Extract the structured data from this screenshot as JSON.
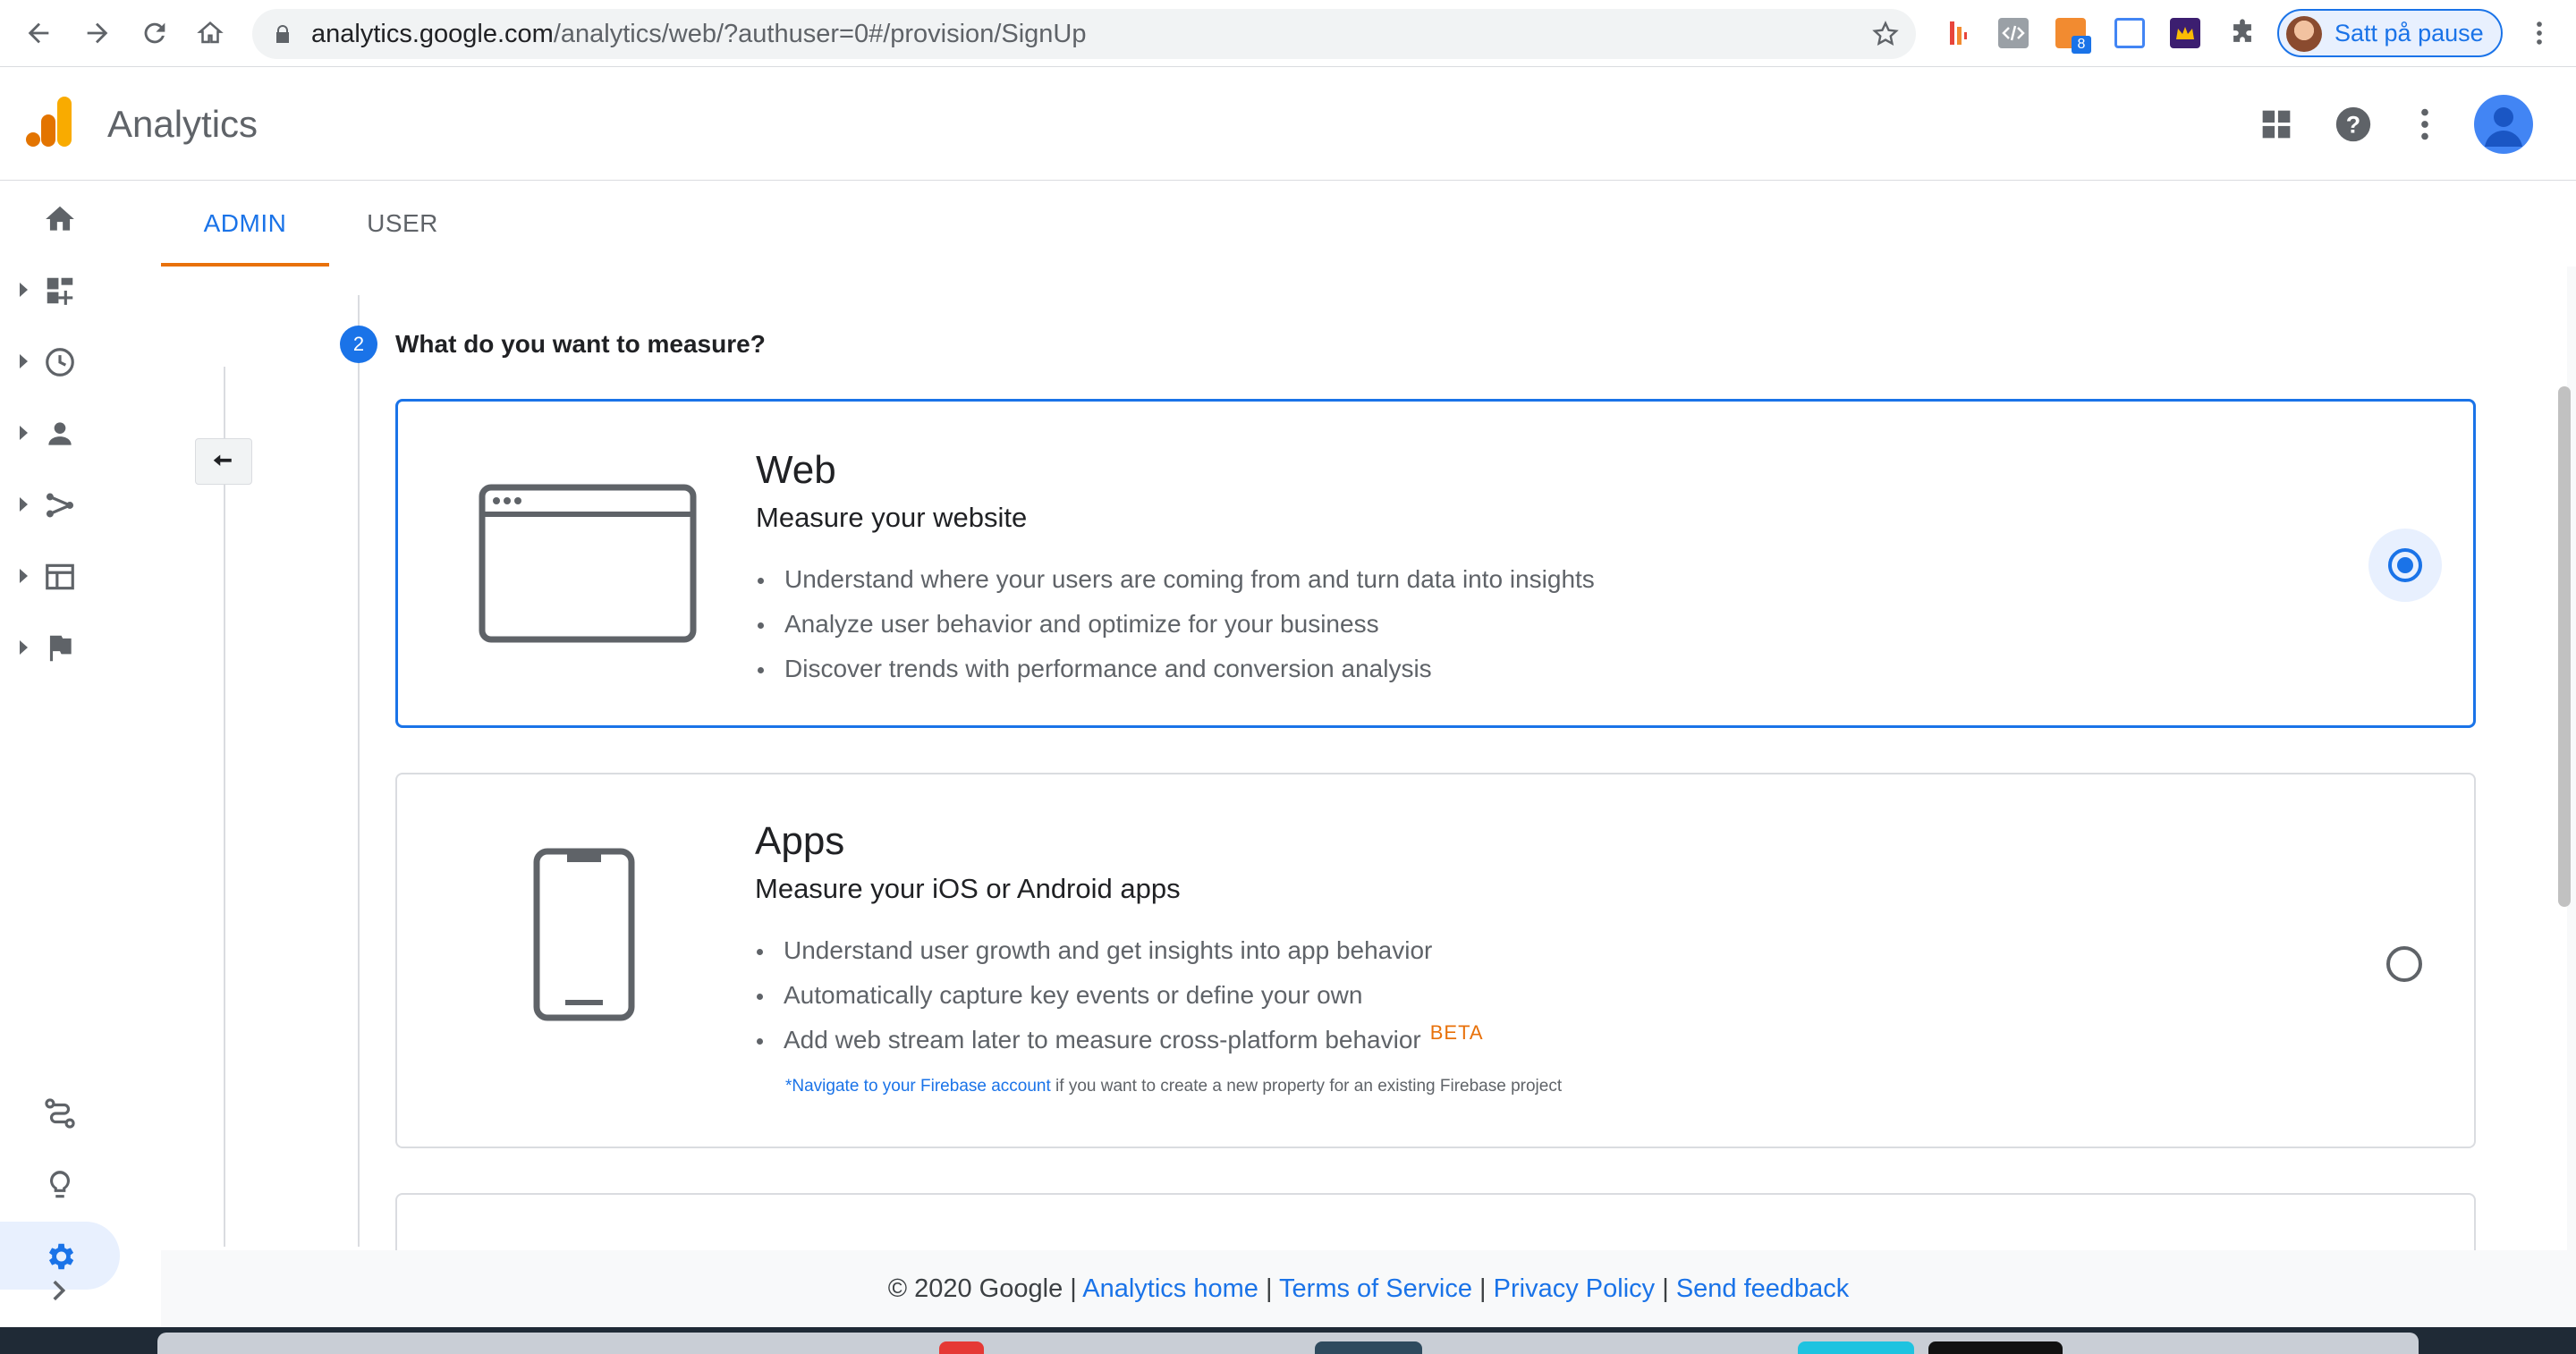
{
  "browser": {
    "url_host": "analytics.google.com",
    "url_path": "/analytics/web/?authuser=0#/provision/SignUp",
    "profile_label": "Satt på pause",
    "extension_badge": "8"
  },
  "app": {
    "title": "Analytics"
  },
  "tabs": [
    {
      "label": "ADMIN",
      "active": true
    },
    {
      "label": "USER",
      "active": false
    }
  ],
  "step": {
    "number": "2",
    "title": "What do you want to measure?"
  },
  "cards": {
    "web": {
      "title": "Web",
      "subtitle": "Measure your website",
      "bullets": [
        "Understand where your users are coming from and turn data into insights",
        "Analyze user behavior and optimize for your business",
        "Discover trends with performance and conversion analysis"
      ],
      "selected": true
    },
    "apps": {
      "title": "Apps",
      "subtitle": "Measure your iOS or Android apps",
      "bullets": [
        "Understand user growth and get insights into app behavior",
        "Automatically capture key events or define your own",
        "Add web stream later to measure cross-platform behavior"
      ],
      "beta": "BETA",
      "note_link": "*Navigate to your Firebase account",
      "note_text": " if you want to create a new property for an existing Firebase project",
      "selected": false
    }
  },
  "footer": {
    "copyright": "© 2020 Google",
    "sep": " | ",
    "links": [
      "Analytics home",
      "Terms of Service",
      "Privacy Policy",
      "Send feedback"
    ]
  },
  "colors": {
    "accent": "#1a73e8",
    "tab_underline": "#e8710a",
    "logo_orange": "#f9ab00",
    "logo_dark_orange": "#e37400"
  },
  "icons": {
    "left_nav": [
      "home-icon",
      "dashboard-icon",
      "clock-icon",
      "person-icon",
      "acquisition-icon",
      "behavior-icon",
      "flag-icon",
      "attribution-icon",
      "lightbulb-icon",
      "gear-icon"
    ]
  }
}
